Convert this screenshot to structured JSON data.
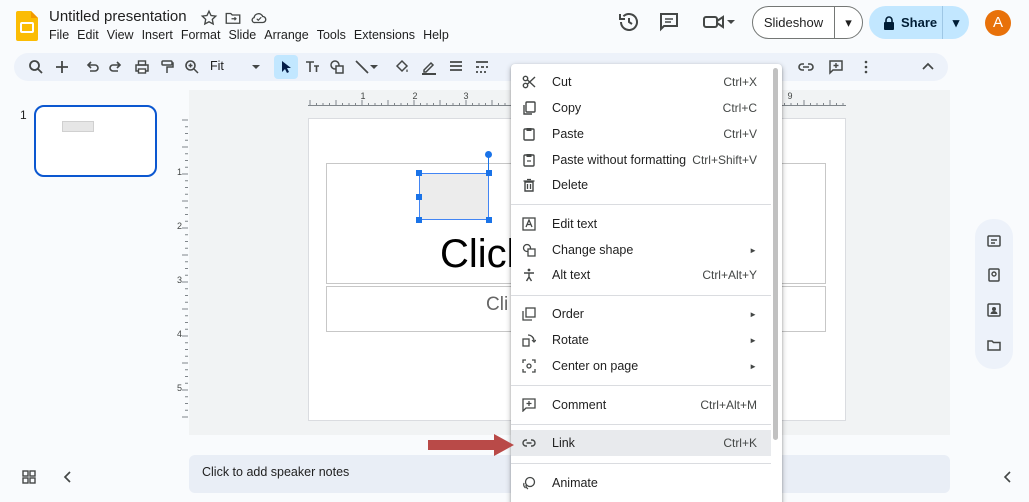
{
  "app": {
    "title": "Untitled presentation",
    "menus": [
      "File",
      "Edit",
      "View",
      "Insert",
      "Format",
      "Slide",
      "Arrange",
      "Tools",
      "Extensions",
      "Help"
    ],
    "slideshow_label": "Slideshow",
    "share_label": "Share",
    "avatar_letter": "A",
    "accent": "#0b57d0"
  },
  "toolbar": {
    "zoom": "Fit"
  },
  "slides": {
    "number": "1"
  },
  "slide": {
    "title_placeholder": "Click",
    "subtitle_placeholder": "Cli"
  },
  "ruler": {
    "top": [
      "1",
      "2",
      "3",
      "9"
    ],
    "left": [
      "1",
      "2",
      "3",
      "4",
      "5"
    ]
  },
  "notes": {
    "placeholder": "Click to add speaker notes"
  },
  "context_menu": {
    "items": [
      {
        "label": "Cut",
        "shortcut": "Ctrl+X",
        "icon": "scissors-icon"
      },
      {
        "label": "Copy",
        "shortcut": "Ctrl+C",
        "icon": "copy-icon"
      },
      {
        "label": "Paste",
        "shortcut": "Ctrl+V",
        "icon": "clipboard-icon"
      },
      {
        "label": "Paste without formatting",
        "shortcut": "Ctrl+Shift+V",
        "icon": "paste-plain-icon"
      },
      {
        "label": "Delete",
        "shortcut": "",
        "icon": "trash-icon"
      },
      {
        "label": "Edit text",
        "shortcut": "",
        "icon": "edit-text-icon"
      },
      {
        "label": "Change shape",
        "shortcut": "",
        "icon": "shapes-icon",
        "submenu": true
      },
      {
        "label": "Alt text",
        "shortcut": "Ctrl+Alt+Y",
        "icon": "accessibility-icon"
      },
      {
        "label": "Order",
        "shortcut": "",
        "icon": "order-icon",
        "submenu": true
      },
      {
        "label": "Rotate",
        "shortcut": "",
        "icon": "rotate-icon",
        "submenu": true
      },
      {
        "label": "Center on page",
        "shortcut": "",
        "icon": "center-icon",
        "submenu": true
      },
      {
        "label": "Comment",
        "shortcut": "Ctrl+Alt+M",
        "icon": "comment-icon"
      },
      {
        "label": "Link",
        "shortcut": "Ctrl+K",
        "icon": "link-icon",
        "highlighted": true
      },
      {
        "label": "Animate",
        "shortcut": "",
        "icon": "animate-icon"
      }
    ]
  }
}
